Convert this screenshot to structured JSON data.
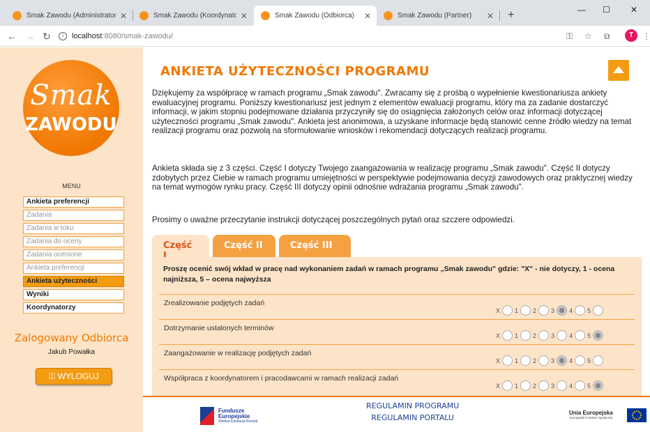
{
  "browser": {
    "tabs": [
      {
        "title": "Smak Zawodu (Administrator)",
        "active": false
      },
      {
        "title": "Smak Zawodu (Koordynator)",
        "active": false
      },
      {
        "title": "Smak Zawodu (Odbiorca)",
        "active": true
      },
      {
        "title": "Smak Zawodu (Partner)",
        "active": false
      }
    ],
    "url_host": "localhost",
    "url_path": ":8080/smak-zawodu/",
    "profile_initial": "T"
  },
  "sidebar": {
    "logo_top": "Smak",
    "logo_bottom": "ZAWODU",
    "menu_title": "MENU",
    "menu": [
      {
        "label": "Ankieta preferencji",
        "state": "normal"
      },
      {
        "label": "Zadania",
        "state": "disabled"
      },
      {
        "label": "Zadania w toku",
        "state": "disabled"
      },
      {
        "label": "Zadania do oceny",
        "state": "disabled"
      },
      {
        "label": "Zadania ocenione",
        "state": "disabled"
      },
      {
        "label": "Ankieta preferencji",
        "state": "disabled"
      },
      {
        "label": "Ankieta użyteczności",
        "state": "active"
      },
      {
        "label": "Wyniki",
        "state": "normal"
      },
      {
        "label": "Koordynatorzy",
        "state": "normal"
      }
    ],
    "logged_label": "Zalogowany Odbiorca",
    "username": "Jakub Powałka",
    "logout_label": "WYLOGUJ"
  },
  "main": {
    "title": "ANKIETA UŻYTECZNOŚCI PROGRAMU",
    "paragraphs": [
      "Dziękujemy za współpracę w ramach programu „Smak zawodu\". Zwracamy się z prośbą o wypełnienie kwestionariusza ankiety ewaluacyjnej programu. Poniższy kwestionariusz jest jednym z elementów ewaluacji programu, który ma za zadanie dostarczyć informacji, w jakim stopniu podejmowane działania przyczyniły się do osiągnięcia założonych celów oraz informacji dotyczącej użyteczności programu „Smak zawodu\". Ankieta jest anonimowa, a uzyskane informacje będą stanowić cenne źródło wiedzy na temat realizacji programu oraz pozwolą na sformułowanie wniosków i rekomendacji dotyczących realizacji programu.",
      "Ankieta składa się z 3 części. Część I dotyczy Twojego zaangażowania w realizację programu „Smak zawodu\". Część II dotyczy zdobytych przez Ciebie w ramach programu umiejętności w perspektywie podejmowania decyzji zawodowych oraz praktycznej wiedzy na temat wymogów rynku pracy. Część III dotyczy opinii odnośnie wdrażania programu „Smak zawodu\".",
      "Prosimy o uważne przeczytanie instrukcji dotyczącej poszczególnych pytań oraz szczere odpowiedzi."
    ],
    "tabs": [
      "Część I",
      "Część II",
      "Część III"
    ],
    "instruction": "Proszę ocenić swój wkład w pracę nad wykonaniem zadań w ramach programu „Smak zawodu\" gdzie: \"X\" - nie dotyczy, 1 - ocena najniższa, 5 – ocena najwyższa",
    "scale_labels": [
      "X",
      "1",
      "2",
      "3",
      "4",
      "5"
    ],
    "questions": [
      {
        "text": "Zrealizowanie podjętych zadań",
        "selected": "3"
      },
      {
        "text": "Dotrzymanie ustalonych terminów",
        "selected": "5"
      },
      {
        "text": "Zaangażowanie w realizację podjętych zadań",
        "selected": "3"
      },
      {
        "text": "Współpraca z koordynatorem i pracodawcami w ramach realizacji zadań",
        "selected": "5"
      }
    ]
  },
  "footer": {
    "eu_funds_title": "Fundusze Europejskie",
    "eu_funds_sub": "Wiedza Edukacja Rozwój",
    "link1": "REGULAMIN PROGRAMU",
    "link2": "REGULAMIN PORTALU",
    "eu_union_title": "Unia Europejska",
    "eu_union_sub": "Europejski Fundusz Społeczny"
  }
}
